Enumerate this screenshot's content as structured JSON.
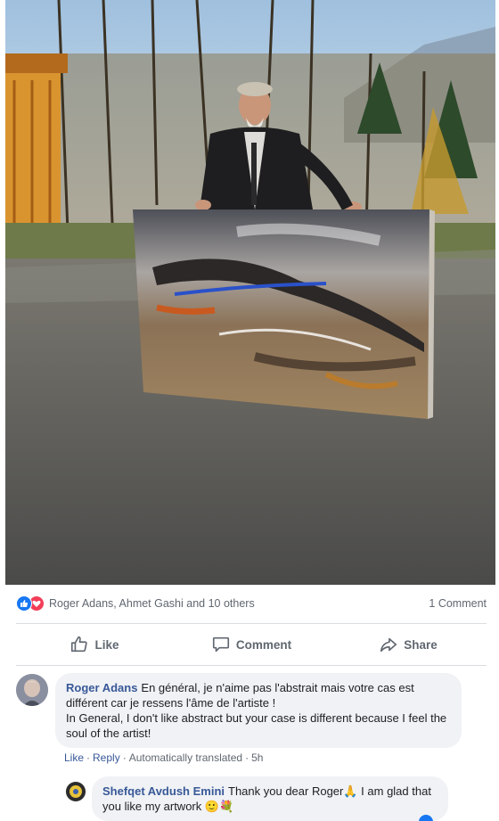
{
  "post": {
    "photo_alt": "photo",
    "reactions": {
      "names": "Roger Adans, Ahmet Gashi and 10 others",
      "comment_count": "1 Comment",
      "like_icon": "thumbs-up-icon",
      "love_icon": "heart-icon"
    },
    "actions": {
      "like": "Like",
      "comment": "Comment",
      "share": "Share"
    }
  },
  "comments": [
    {
      "author": "Roger Adans",
      "text_fr": "En général, je n'aime pas l'abstrait mais votre cas est différent car je ressens l'âme de l'artiste !",
      "text_en": "In General, I don't like abstract but your case is different because I feel the soul of the artist!",
      "meta": {
        "like": "Like",
        "reply": "Reply",
        "translated": "Automatically translated",
        "time": "5h"
      }
    },
    {
      "author": "Shefqet Avdush Emini",
      "text": "Thank you dear Roger",
      "text_2": "I am glad that you like my artwork",
      "emoji_1": "🙏",
      "emoji_2": "🙂",
      "emoji_3": "💐"
    }
  ],
  "colors": {
    "link": "#385898",
    "like_blue": "#1877f2",
    "love_red": "#f33e58",
    "bubble_bg": "#f0f2f5"
  }
}
